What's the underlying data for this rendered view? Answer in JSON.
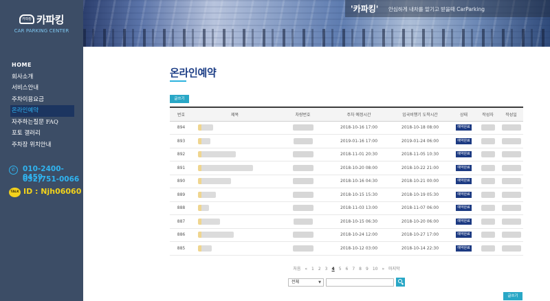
{
  "logo": {
    "title": "카파킹",
    "subtitle": "CAR PARKING CENTER",
    "car_badge": "카파킹"
  },
  "nav": [
    {
      "label": "HOME",
      "active": false
    },
    {
      "label": "회사소개",
      "active": false
    },
    {
      "label": "서비스안내",
      "active": false
    },
    {
      "label": "주차이용요금",
      "active": false
    },
    {
      "label": "온라인예약",
      "active": true
    },
    {
      "label": "자주하는질문 FAQ",
      "active": false
    },
    {
      "label": "포토 갤러리",
      "active": false
    },
    {
      "label": "주차장 위치안내",
      "active": false
    }
  ],
  "contact": {
    "phone1": "010-2400-0459",
    "phone2": "032)751-0066",
    "talk_label": "TALK",
    "talk_id": "ID : Njh06060"
  },
  "header": {
    "brand": "'카파킹'",
    "tagline": "안심하게 내차를 맡기고 받을때 CarParking"
  },
  "page": {
    "title": "온라인예약",
    "write_label": "글쓰기"
  },
  "table": {
    "columns": [
      "번호",
      "제목",
      "차량번호",
      "주차 예정시간",
      "입국비행기 도착시간",
      "상태",
      "작성자",
      "작성일"
    ],
    "rows": [
      {
        "no": "894",
        "park": "2018-10-16 17:00",
        "arrive": "2018-10-18 08:00",
        "status": "예약완료"
      },
      {
        "no": "893",
        "park": "2019-01-16 17:00",
        "arrive": "2019-01-24 06:00",
        "status": "예약완료"
      },
      {
        "no": "892",
        "park": "2018-11-01 20:30",
        "arrive": "2018-11-05 10:30",
        "status": "예약완료"
      },
      {
        "no": "891",
        "park": "2018-10-20 08:00",
        "arrive": "2018-10-22 21:00",
        "status": "예약완료"
      },
      {
        "no": "890",
        "park": "2018-10-16 04:30",
        "arrive": "2018-10-21 00:00",
        "status": "예약완료"
      },
      {
        "no": "889",
        "park": "2018-10-15 15:30",
        "arrive": "2018-10-19 05:30",
        "status": "예약완료"
      },
      {
        "no": "888",
        "park": "2018-11-03 13:00",
        "arrive": "2018-11-07 06:00",
        "status": "예약완료"
      },
      {
        "no": "887",
        "park": "2018-10-15 06:30",
        "arrive": "2018-10-20 06:00",
        "status": "예약완료"
      },
      {
        "no": "886",
        "park": "2018-10-24 12:00",
        "arrive": "2018-10-27 17:00",
        "status": "예약완료"
      },
      {
        "no": "885",
        "park": "2018-10-12 03:00",
        "arrive": "2018-10-14 22:30",
        "status": "예약완료"
      }
    ]
  },
  "pagination": {
    "first": "처음",
    "prev": "«",
    "pages": [
      "1",
      "2",
      "3",
      "4",
      "5",
      "6",
      "7",
      "8",
      "9",
      "10"
    ],
    "current": "4",
    "next": "»",
    "last": "마지막"
  },
  "search": {
    "select_value": "전체",
    "input_value": ""
  }
}
